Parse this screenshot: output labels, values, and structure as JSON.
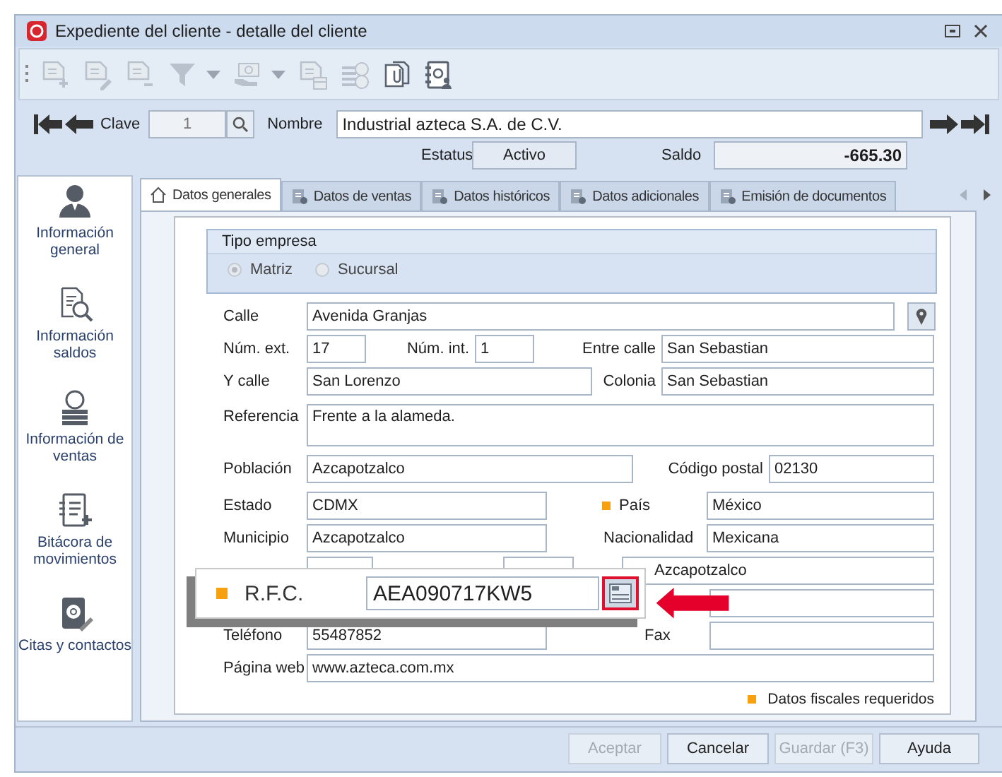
{
  "window": {
    "title": "Expediente del cliente - detalle del cliente"
  },
  "toolbar": [
    {
      "kind": "button",
      "disabled": true
    },
    {
      "kind": "button",
      "disabled": true
    },
    {
      "kind": "button",
      "disabled": true
    },
    {
      "kind": "dropdown",
      "disabled": true
    },
    {
      "kind": "dropdown",
      "disabled": true
    },
    {
      "kind": "button",
      "disabled": true
    },
    {
      "kind": "button",
      "disabled": true
    },
    {
      "kind": "button",
      "disabled": false
    },
    {
      "kind": "button",
      "disabled": false
    }
  ],
  "header": {
    "clave_label": "Clave",
    "clave": "1",
    "nombre_label": "Nombre",
    "nombre": "Industrial azteca S.A. de C.V.",
    "estatus_label": "Estatus",
    "estatus": "Activo",
    "saldo_label": "Saldo",
    "saldo": "-665.30"
  },
  "sidebar": [
    {
      "label": "Información general"
    },
    {
      "label": "Información saldos"
    },
    {
      "label": "Información de ventas"
    },
    {
      "label": "Bitácora de movimientos"
    },
    {
      "label": "Citas y contactos"
    }
  ],
  "tabs": [
    {
      "label": "Datos generales",
      "selected": true
    },
    {
      "label": "Datos de ventas",
      "selected": false
    },
    {
      "label": "Datos históricos",
      "selected": false
    },
    {
      "label": "Datos adicionales",
      "selected": false
    },
    {
      "label": "Emisión de documentos",
      "selected": false
    }
  ],
  "tipo_empresa": {
    "title": "Tipo empresa",
    "options": [
      {
        "label": "Matriz",
        "selected": true
      },
      {
        "label": "Sucursal",
        "selected": false
      }
    ]
  },
  "form": {
    "calle": {
      "label": "Calle",
      "value": "Avenida Granjas"
    },
    "num_ext": {
      "label": "Núm. ext.",
      "value": "17"
    },
    "num_int": {
      "label": "Núm. int.",
      "value": "1"
    },
    "entre_calle": {
      "label": "Entre calle",
      "value": "San Sebastian"
    },
    "y_calle": {
      "label": "Y calle",
      "value": "San Lorenzo"
    },
    "colonia": {
      "label": "Colonia",
      "value": "San Sebastian"
    },
    "referencia": {
      "label": "Referencia",
      "value": "Frente a la alameda."
    },
    "poblacion": {
      "label": "Población",
      "value": "Azcapotzalco"
    },
    "codigo_postal": {
      "label": "Código postal",
      "value": "02130"
    },
    "estado": {
      "label": "Estado",
      "value": "CDMX"
    },
    "pais": {
      "label": "País",
      "value": "México",
      "required": true
    },
    "municipio": {
      "label": "Municipio",
      "value": "Azcapotzalco"
    },
    "nacionalidad": {
      "label": "Nacionalidad",
      "value": "Mexicana"
    },
    "column_3": {
      "value": "Azcapotzalco"
    },
    "telefono": {
      "label": "Teléfono",
      "value": "55487852"
    },
    "fax": {
      "label": "Fax"
    },
    "pagina_web": {
      "label": "Página web",
      "value": "www.azteca.com.mx"
    },
    "legend": "Datos fiscales requeridos"
  },
  "rfc_callout": {
    "label": "R.F.C.",
    "value": "AEA090717KW5",
    "required": true
  },
  "buttons": [
    {
      "label": "Aceptar",
      "disabled": true
    },
    {
      "label": "Cancelar",
      "disabled": false
    },
    {
      "label": "Guardar (F3)",
      "disabled": true
    },
    {
      "label": "Ayuda",
      "disabled": false
    }
  ]
}
